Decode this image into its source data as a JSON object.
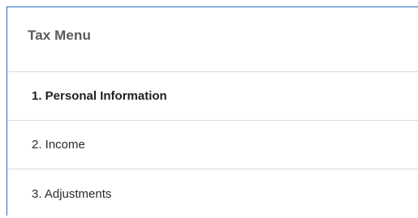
{
  "menu": {
    "title": "Tax Menu",
    "items": [
      {
        "label": "1. Personal Information",
        "active": true
      },
      {
        "label": "2. Income",
        "active": false
      },
      {
        "label": "3. Adjustments",
        "active": false
      }
    ]
  },
  "colors": {
    "panel_border": "#2a6ebf",
    "divider": "#d9d9d9",
    "title_text": "#5a5a5a",
    "item_text": "#2b2b2b"
  }
}
